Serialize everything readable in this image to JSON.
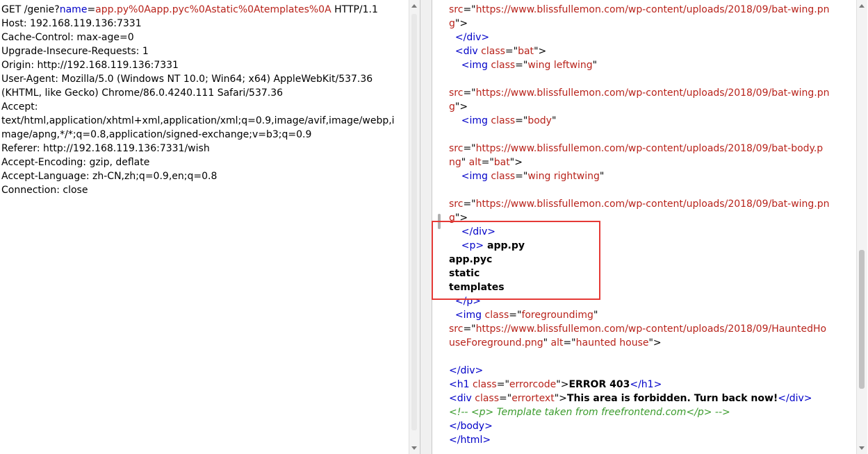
{
  "request": {
    "lines": [
      [
        {
          "t": "GET /genie?",
          "c": "k"
        },
        {
          "t": "name",
          "c": "param"
        },
        {
          "t": "=",
          "c": "k"
        },
        {
          "t": "app.py%0Aapp.pyc%0Astatic%0Atemplates%0A",
          "c": "val"
        },
        {
          "t": " HTTP/1.1",
          "c": "k"
        }
      ],
      [
        {
          "t": "Host: 192.168.119.136:7331",
          "c": "k"
        }
      ],
      [
        {
          "t": "Cache-Control: max-age=0",
          "c": "k"
        }
      ],
      [
        {
          "t": "Upgrade-Insecure-Requests: 1",
          "c": "k"
        }
      ],
      [
        {
          "t": "Origin: http://192.168.119.136:7331",
          "c": "k"
        }
      ],
      [
        {
          "t": "User-Agent: Mozilla/5.0 (Windows NT 10.0; Win64; x64) AppleWebKit/537.36",
          "c": "k"
        }
      ],
      [
        {
          "t": "(KHTML, like Gecko) Chrome/86.0.4240.111 Safari/537.36",
          "c": "k"
        }
      ],
      [
        {
          "t": "Accept:",
          "c": "k"
        }
      ],
      [
        {
          "t": "text/html,application/xhtml+xml,application/xml;q=0.9,image/avif,image/webp,i",
          "c": "k"
        }
      ],
      [
        {
          "t": "mage/apng,*/*;q=0.8,application/signed-exchange;v=b3;q=0.9",
          "c": "k"
        }
      ],
      [
        {
          "t": "Referer: http://192.168.119.136:7331/wish",
          "c": "k"
        }
      ],
      [
        {
          "t": "Accept-Encoding: gzip, deflate",
          "c": "k"
        }
      ],
      [
        {
          "t": "Accept-Language: zh-CN,zh;q=0.9,en;q=0.8",
          "c": "k"
        }
      ],
      [
        {
          "t": "Connection: close",
          "c": "k"
        }
      ]
    ]
  },
  "response": {
    "lines": [
      [
        {
          "t": "src",
          "c": "attr"
        },
        {
          "t": "=\"",
          "c": "k"
        },
        {
          "t": "https://www.blissfullemon.com/wp-content/uploads/2018/09/bat-wing.pn",
          "c": "str"
        }
      ],
      [
        {
          "t": "g",
          "c": "str"
        },
        {
          "t": "\">",
          "c": "k"
        }
      ],
      [
        {
          "t": "  </div>",
          "c": "tag"
        }
      ],
      [
        {
          "t": "  <div ",
          "c": "tag"
        },
        {
          "t": "class",
          "c": "attr"
        },
        {
          "t": "=\"",
          "c": "k"
        },
        {
          "t": "bat",
          "c": "str"
        },
        {
          "t": "\">",
          "c": "k"
        }
      ],
      [
        {
          "t": "    <img ",
          "c": "tag"
        },
        {
          "t": "class",
          "c": "attr"
        },
        {
          "t": "=\"",
          "c": "k"
        },
        {
          "t": "wing leftwing",
          "c": "str"
        },
        {
          "t": "\"",
          "c": "k"
        }
      ],
      [],
      [
        {
          "t": "src",
          "c": "attr"
        },
        {
          "t": "=\"",
          "c": "k"
        },
        {
          "t": "https://www.blissfullemon.com/wp-content/uploads/2018/09/bat-wing.pn",
          "c": "str"
        }
      ],
      [
        {
          "t": "g",
          "c": "str"
        },
        {
          "t": "\">",
          "c": "k"
        }
      ],
      [
        {
          "t": "    <img ",
          "c": "tag"
        },
        {
          "t": "class",
          "c": "attr"
        },
        {
          "t": "=\"",
          "c": "k"
        },
        {
          "t": "body",
          "c": "str"
        },
        {
          "t": "\"",
          "c": "k"
        }
      ],
      [],
      [
        {
          "t": "src",
          "c": "attr"
        },
        {
          "t": "=\"",
          "c": "k"
        },
        {
          "t": "https://www.blissfullemon.com/wp-content/uploads/2018/09/bat-body.p",
          "c": "str"
        }
      ],
      [
        {
          "t": "ng",
          "c": "str"
        },
        {
          "t": "\" ",
          "c": "k"
        },
        {
          "t": "alt",
          "c": "attr"
        },
        {
          "t": "=\"",
          "c": "k"
        },
        {
          "t": "bat",
          "c": "str"
        },
        {
          "t": "\">",
          "c": "k"
        }
      ],
      [
        {
          "t": "    <img ",
          "c": "tag"
        },
        {
          "t": "class",
          "c": "attr"
        },
        {
          "t": "=\"",
          "c": "k"
        },
        {
          "t": "wing rightwing",
          "c": "str"
        },
        {
          "t": "\"",
          "c": "k"
        }
      ],
      [],
      [
        {
          "t": "src",
          "c": "attr"
        },
        {
          "t": "=\"",
          "c": "k"
        },
        {
          "t": "https://www.blissfullemon.com/wp-content/uploads/2018/09/bat-wing.pn",
          "c": "str"
        }
      ],
      [
        {
          "t": "g",
          "c": "str"
        },
        {
          "t": "\">",
          "c": "k"
        }
      ],
      [
        {
          "t": "    </div>",
          "c": "tag"
        }
      ],
      [
        {
          "t": "    <p>",
          "c": "tag"
        },
        {
          "t": " app.py",
          "c": "bold"
        }
      ],
      [
        {
          "t": "app.pyc",
          "c": "bold"
        }
      ],
      [
        {
          "t": "static",
          "c": "bold"
        }
      ],
      [
        {
          "t": "templates",
          "c": "bold"
        }
      ],
      [
        {
          "t": "  </p>",
          "c": "tag"
        }
      ],
      [
        {
          "t": "  <img ",
          "c": "tag"
        },
        {
          "t": "class",
          "c": "attr"
        },
        {
          "t": "=\"",
          "c": "k"
        },
        {
          "t": "foregroundimg",
          "c": "str"
        },
        {
          "t": "\"",
          "c": "k"
        }
      ],
      [
        {
          "t": "src",
          "c": "attr"
        },
        {
          "t": "=\"",
          "c": "k"
        },
        {
          "t": "https://www.blissfullemon.com/wp-content/uploads/2018/09/HauntedHo",
          "c": "str"
        }
      ],
      [
        {
          "t": "useForeground.png",
          "c": "str"
        },
        {
          "t": "\" ",
          "c": "k"
        },
        {
          "t": "alt",
          "c": "attr"
        },
        {
          "t": "=\"",
          "c": "k"
        },
        {
          "t": "haunted house",
          "c": "str"
        },
        {
          "t": "\">",
          "c": "k"
        }
      ],
      [],
      [
        {
          "t": "</div>",
          "c": "tag"
        }
      ],
      [
        {
          "t": "<h1 ",
          "c": "tag"
        },
        {
          "t": "class",
          "c": "attr"
        },
        {
          "t": "=\"",
          "c": "k"
        },
        {
          "t": "errorcode",
          "c": "str"
        },
        {
          "t": "\">",
          "c": "k"
        },
        {
          "t": "ERROR 403",
          "c": "bold"
        },
        {
          "t": "</h1>",
          "c": "tag"
        }
      ],
      [
        {
          "t": "<div ",
          "c": "tag"
        },
        {
          "t": "class",
          "c": "attr"
        },
        {
          "t": "=\"",
          "c": "k"
        },
        {
          "t": "errortext",
          "c": "str"
        },
        {
          "t": "\">",
          "c": "k"
        },
        {
          "t": "This area is forbidden. Turn back now!",
          "c": "bold"
        },
        {
          "t": "</div>",
          "c": "tag"
        }
      ],
      [
        {
          "t": "<!-- <p> Template taken from freefrontend.com</p> -->",
          "c": "comment"
        }
      ],
      [
        {
          "t": "</body>",
          "c": "tag"
        }
      ],
      [
        {
          "t": "</html>",
          "c": "tag"
        }
      ]
    ]
  },
  "colors": {
    "tag": "#0000c8",
    "attribute": "#b8231b",
    "string": "#b8231b",
    "comment": "#3a9b2c",
    "highlight_box": "#e53935"
  },
  "icons": {
    "scroll_up": "scroll-up-arrow-icon",
    "scroll_down": "scroll-down-arrow-icon"
  }
}
